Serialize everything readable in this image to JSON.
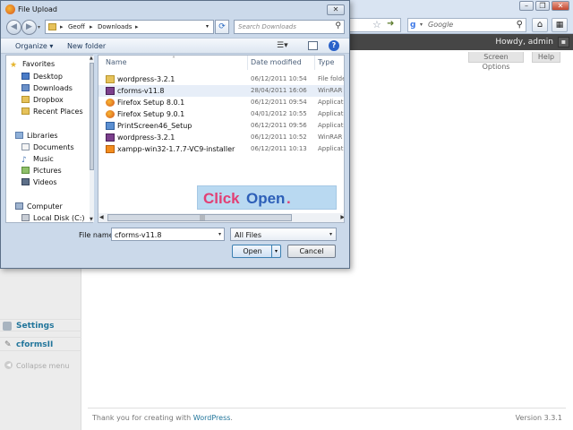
{
  "browser": {
    "search_placeholder": "Google",
    "howdy": "Howdy, admin",
    "screen_options": "Screen Options",
    "help": "Help"
  },
  "wp": {
    "menu": {
      "settings": "Settings",
      "cforms": "cformsII",
      "collapse": "Collapse menu"
    },
    "footer": {
      "thanks_prefix": "Thank you for creating with",
      "thanks_link": "WordPress",
      "thanks_suffix": ".",
      "version": "Version 3.3.1"
    }
  },
  "dialog": {
    "title": "File Upload",
    "breadcrumb": [
      "Geoff",
      "Downloads"
    ],
    "search_placeholder": "Search Downloads",
    "toolbar": {
      "organize": "Organize",
      "new_folder": "New folder"
    },
    "nav": {
      "favorites": "Favorites",
      "desktop": "Desktop",
      "downloads": "Downloads",
      "dropbox": "Dropbox",
      "recent": "Recent Places",
      "libraries": "Libraries",
      "documents": "Documents",
      "music": "Music",
      "pictures": "Pictures",
      "videos": "Videos",
      "computer": "Computer",
      "local_disk": "Local Disk (C:)"
    },
    "columns": {
      "name": "Name",
      "date": "Date modified",
      "type": "Type"
    },
    "files": [
      {
        "name": "wordpress-3.2.1",
        "date": "06/12/2011 10:54",
        "type": "File folder"
      },
      {
        "name": "cforms-v11.8",
        "date": "28/04/2011 16:06",
        "type": "WinRAR Z"
      },
      {
        "name": "Firefox Setup 8.0.1",
        "date": "06/12/2011 09:54",
        "type": "Applicatio"
      },
      {
        "name": "Firefox Setup 9.0.1",
        "date": "04/01/2012 10:55",
        "type": "Applicatio"
      },
      {
        "name": "PrintScreen46_Setup",
        "date": "06/12/2011 09:56",
        "type": "Applicatio"
      },
      {
        "name": "wordpress-3.2.1",
        "date": "06/12/2011 10:52",
        "type": "WinRAR Z"
      },
      {
        "name": "xampp-win32-1.7.7-VC9-installer",
        "date": "06/12/2011 10:13",
        "type": "Applicatio"
      }
    ],
    "banner": {
      "click": "Click",
      "open": "Open",
      "dot": "."
    },
    "file_name_label": "File name:",
    "file_name_value": "cforms-v11.8",
    "file_type": "All Files",
    "open_button": "Open",
    "cancel_button": "Cancel"
  },
  "colors": {
    "banner_pink": "#e23f74",
    "banner_blue": "#2d5fb8",
    "wp_link": "#21759b"
  }
}
